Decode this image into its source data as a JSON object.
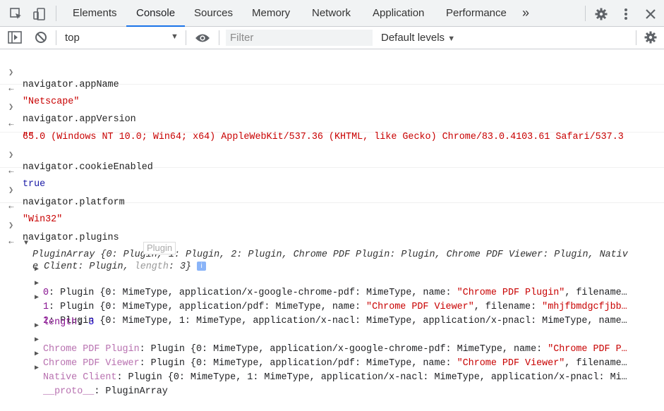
{
  "tabs": [
    "Elements",
    "Console",
    "Sources",
    "Memory",
    "Network",
    "Application",
    "Performance"
  ],
  "more_tabs_label": "»",
  "toolbar": {
    "context": "top",
    "filter_placeholder": "Filter",
    "levels": "Default levels"
  },
  "tooltip": "Plugin",
  "entries": [
    {
      "input": "navigator.appName",
      "output": "\"Netscape\""
    },
    {
      "input": "navigator.appVersion",
      "output_line1": "\"5.0 (Windows NT 10.0; Win64; x64) AppleWebKit/537.36 (KHTML, like Gecko) Chrome/83.0.4103.61 Safari/537.3",
      "output_line2": "6\""
    },
    {
      "input": "navigator.cookieEnabled",
      "output": "true"
    },
    {
      "input": "navigator.platform",
      "output": "\"Win32\""
    },
    {
      "input": "navigator.plugins"
    }
  ],
  "plugins_output": {
    "summary_line1": "PluginArray {0: Plugin, 1: Plugin, 2: Plugin, Chrome PDF Plugin: Plugin, Chrome PDF Viewer: Plugin, Nativ",
    "summary_line2_a": "e Client: Plugin, ",
    "summary_line2_b": "length",
    "summary_line2_c": ": 3}",
    "rows": [
      {
        "key": "0",
        "pre": ": Plugin {0: MimeType, application/x-google-chrome-pdf: MimeType, name: ",
        "str": "\"Chrome PDF Plugin\"",
        "post": ", filename…"
      },
      {
        "key": "1",
        "pre": ": Plugin {0: MimeType, application/pdf: MimeType, name: ",
        "str": "\"Chrome PDF Viewer\"",
        "post": ", filename: ",
        "str2": "\"mhjfbmdgcfjbb…"
      },
      {
        "key": "2",
        "pre": ": Plugin {0: MimeType, 1: MimeType, application/x-nacl: MimeType, application/x-pnacl: MimeType, name…",
        "str": "",
        "post": ""
      },
      {
        "key": "length",
        "pre": ": ",
        "num": "3"
      },
      {
        "key": "Chrome PDF Plugin",
        "pre": ": Plugin {0: MimeType, application/x-google-chrome-pdf: MimeType, name: ",
        "str": "\"Chrome PDF P…",
        "post": ""
      },
      {
        "key": "Chrome PDF Viewer",
        "pre": ": Plugin {0: MimeType, application/pdf: MimeType, name: ",
        "str": "\"Chrome PDF Viewer\"",
        "post": ", filename…"
      },
      {
        "key": "Native Client",
        "pre": ": Plugin {0: MimeType, 1: MimeType, application/x-nacl: MimeType, application/x-pnacl: Mi…",
        "str": "",
        "post": ""
      },
      {
        "key": "__proto__",
        "pre": ": PluginArray",
        "str": "",
        "post": ""
      }
    ]
  }
}
